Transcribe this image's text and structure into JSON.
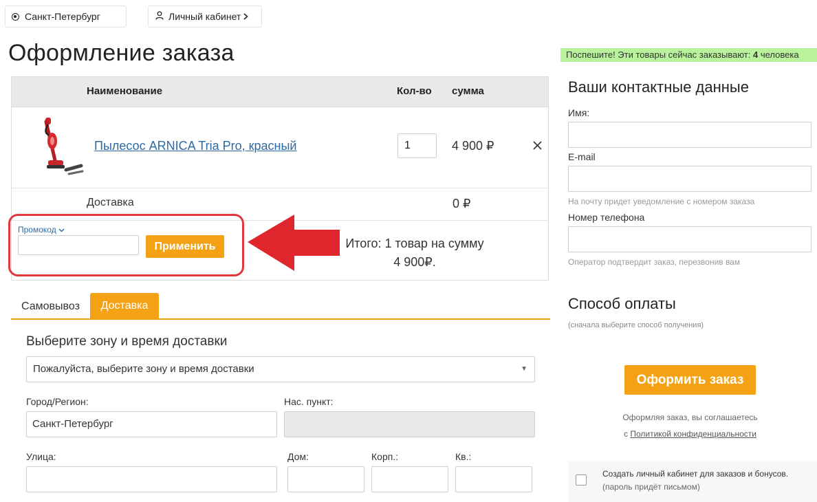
{
  "topbar": {
    "city": "Санкт-Петербург",
    "cabinet": "Личный кабинет"
  },
  "page": {
    "title": "Оформление заказа",
    "hurry_prefix": "Поспешите! Эти товары сейчас заказывают:",
    "hurry_count": "4",
    "hurry_suffix": "человека"
  },
  "cart": {
    "headers": {
      "name": "Наименование",
      "qty": "Кол-во",
      "sum": "сумма"
    },
    "item": {
      "name": "Пылесос ARNICA Tria Pro, красный",
      "qty": "1",
      "price": "4 900 ₽"
    },
    "delivery_label": "Доставка",
    "delivery_value": "0 ₽",
    "promo_label": "Промокод",
    "apply_label": "Применить",
    "total_line1": "Итого: 1 товар на сумму",
    "total_line2": "4 900₽."
  },
  "tabs": {
    "pickup": "Самовывоз",
    "delivery": "Доставка"
  },
  "delivery_form": {
    "zone_title": "Выберите зону и время доставки",
    "zone_select": "Пожалуйста, выберите зону и время доставки",
    "city_label": "Город/Регион:",
    "city_value": "Санкт-Петербург",
    "settlement_label": "Нас. пункт:",
    "street_label": "Улица:",
    "house_label": "Дом:",
    "building_label": "Корп.:",
    "apt_label": "Кв.:"
  },
  "contact": {
    "title": "Ваши контактные данные",
    "name_label": "Имя:",
    "email_label": "E-mail",
    "email_hint": "На почту придет уведомление с номером заказа",
    "phone_label": "Номер телефона",
    "phone_hint": "Оператор подтвердит заказ, перезвонив вам"
  },
  "payment": {
    "title": "Способ оплаты",
    "hint": "(сначала выберите способ получения)",
    "order_button": "Оформить заказ",
    "agree_text": "Оформляя заказ, вы соглашаетесь",
    "agree_prefix": "с",
    "agree_link": "Политикой конфиденциальности"
  },
  "account": {
    "text": "Создать личный кабинет для заказов и бонусов.",
    "sub": "(пароль придёт письмом)"
  },
  "colors": {
    "accent": "#f5a114",
    "link": "#2c6aa6",
    "highlight": "#e0383e",
    "hurry_bg": "#b8f29a"
  },
  "icons": [
    "location-radio-icon",
    "user-icon",
    "chevron-right-icon",
    "chevron-down-icon",
    "close-icon",
    "caret-down-icon",
    "red-arrow-icon"
  ]
}
